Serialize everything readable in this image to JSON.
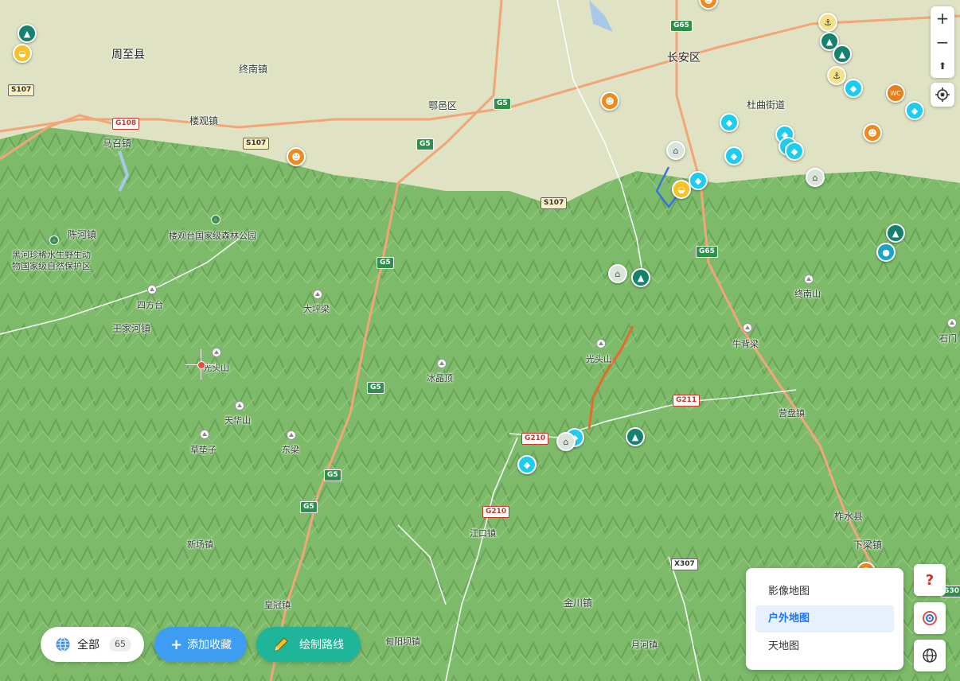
{
  "map": {
    "colors": {
      "mountain": "#7dbb6a",
      "plain": "#dfe3c4",
      "highway": "#f2a678",
      "road": "#ffffff"
    },
    "labels": {
      "zhouzhi": "周至县",
      "zhongnan_town": "终南镇",
      "changan": "长安区",
      "huyi": "鄠邑区",
      "louguan": "楼观镇",
      "duqu": "杜曲街道",
      "mazhao": "马召镇",
      "chenhe": "陈河镇",
      "heihe_reserve_1": "黑河珍稀水生野生动",
      "heihe_reserve_2": "物国家级自然保护区",
      "louguantai": "楼观台国家级森林公园",
      "sifangtai": "四方台",
      "wangjiahe": "王家河镇",
      "dapingliang": "大坪梁",
      "guangtou_w": "光头山",
      "bingjingding": "冰晶顶",
      "tianhua": "天华山",
      "caodianzi": "草垫子",
      "dongliang": "东梁",
      "guangtou_e": "光头山",
      "zhongnanshan": "终南山",
      "niubeiliang": "牛背梁",
      "shimen": "石门",
      "yingpan": "营盘镇",
      "zhashui": "柞水县",
      "xialiang": "下梁镇",
      "jiangkou": "江口镇",
      "xinchang": "新场镇",
      "huangguan": "皇冠镇",
      "jinchuan": "金川镇",
      "yuehe": "月河镇",
      "dianhe": "甸阳坝镇"
    },
    "shields": {
      "s107": "S107",
      "g108": "G108",
      "g65": "G65",
      "g5": "G5",
      "g210": "G210",
      "g211": "G211",
      "x307": "X307",
      "s30": "S30"
    },
    "poi_icons": [
      "fish-icon",
      "anchor-icon",
      "mountain-icon",
      "bowl-icon",
      "devil-icon",
      "house-icon",
      "wc-icon",
      "drop-icon"
    ]
  },
  "controls": {
    "zoom_in": "+",
    "zoom_out": "−",
    "compass": "⬆"
  },
  "layers": {
    "items": [
      "影像地图",
      "户外地图",
      "天地图"
    ],
    "active": "户外地图"
  },
  "bottom": {
    "all_label": "全部",
    "all_count": "65",
    "add_fav_label": "添加收藏",
    "draw_route_label": "绘制路线"
  },
  "buttons": {
    "help": "?"
  }
}
